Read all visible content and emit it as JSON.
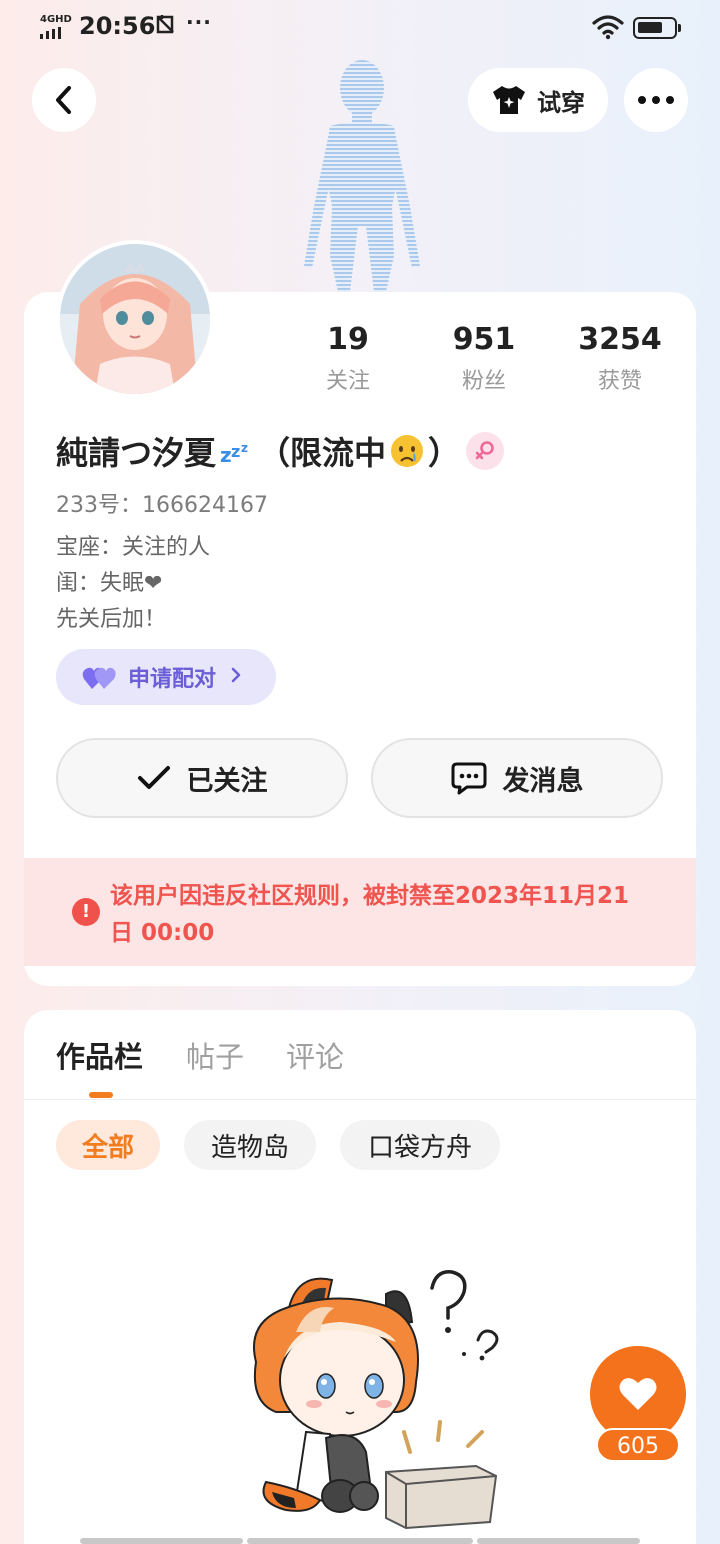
{
  "status_bar": {
    "network": "4GHD",
    "time": "20:56",
    "overflow": "···"
  },
  "nav": {
    "try_on_label": "试穿"
  },
  "profile": {
    "name": "純請つ汐夏",
    "name_suffix_open": "（限流中",
    "name_suffix_close": "）",
    "uid": "233号：166624167",
    "bio_lines": [
      "宝座：关注的人",
      "闺：失眠❤",
      "先关后加！"
    ],
    "pair_label": "申请配对",
    "gender_icon": "female-icon"
  },
  "stats": [
    {
      "value": "19",
      "label": "关注"
    },
    {
      "value": "951",
      "label": "粉丝"
    },
    {
      "value": "3254",
      "label": "获赞"
    }
  ],
  "actions": {
    "follow_label": "已关注",
    "message_label": "发消息"
  },
  "ban_notice": "该用户因违反社区规则，被封禁至2023年11月21日 00:00",
  "tabs": [
    {
      "label": "作品栏",
      "active": true
    },
    {
      "label": "帖子",
      "active": false
    },
    {
      "label": "评论",
      "active": false
    }
  ],
  "chips": [
    {
      "label": "全部",
      "active": true
    },
    {
      "label": "造物岛",
      "active": false
    },
    {
      "label": "口袋方舟",
      "active": false
    }
  ],
  "like_count": "605",
  "colors": {
    "accent": "#f5721c",
    "ban_text": "#ef544f",
    "pair_purple": "#6b5ed6"
  }
}
